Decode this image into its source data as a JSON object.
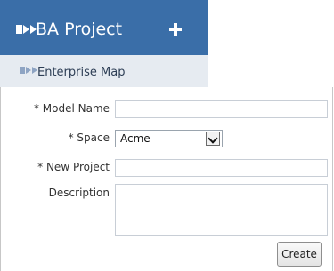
{
  "project": {
    "title": "BA Project",
    "add_icon": "plus-icon",
    "logo_icon": "triple-chevron-logo"
  },
  "tab": {
    "label": "Enterprise Map",
    "logo_icon": "triple-chevron-logo"
  },
  "form": {
    "model_name": {
      "label": "* Model Name",
      "value": ""
    },
    "space": {
      "label": "* Space",
      "value": "Acme"
    },
    "new_project": {
      "label": "* New Project",
      "value": ""
    },
    "description": {
      "label": "Description",
      "value": ""
    },
    "create_label": "Create"
  },
  "colors": {
    "header_bg": "#3a6ea8",
    "subtab_bg": "#e6ebf1"
  }
}
